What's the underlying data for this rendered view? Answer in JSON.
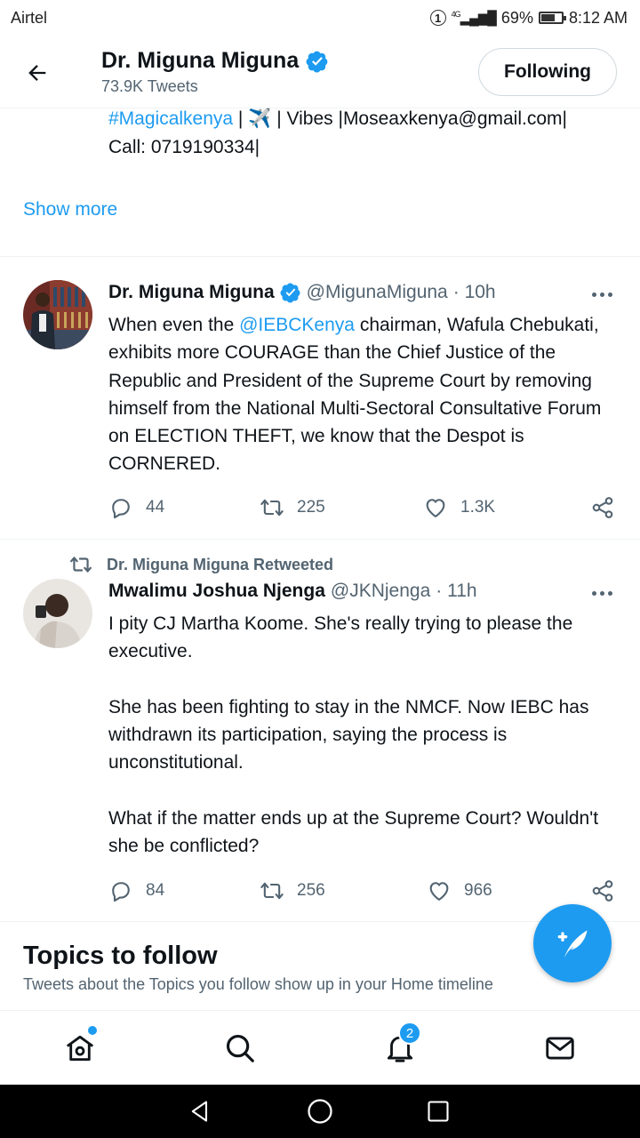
{
  "status": {
    "carrier": "Airtel",
    "net": "4G",
    "battery": "69%",
    "battery_level": 0.69,
    "time": "8:12 AM"
  },
  "header": {
    "name": "Dr. Miguna Miguna",
    "tweets_count": "73.9K Tweets",
    "follow_label": "Following"
  },
  "bio": {
    "hashtag": "#Magicalkenya",
    "sep1": " | ",
    "sep2": " | Vibes |Moseaxkenya@gmail.com|",
    "line2": "Call: 0719190334|",
    "plane_emoji": "✈️",
    "show_more": "Show more"
  },
  "tweet1": {
    "name": "Dr. Miguna Miguna",
    "handle": "@MigunaMiguna",
    "time": "· 10h",
    "text_pre": "When even the ",
    "mention": "@IEBCKenya",
    "text_post": " chairman, Wafula Chebukati, exhibits more COURAGE than the Chief Justice of the Republic and President of the Supreme Court by removing himself from the National Multi-Sectoral Consultative Forum on ELECTION THEFT, we know that the Despot is CORNERED.",
    "replies": "44",
    "retweets": "225",
    "likes": "1.3K"
  },
  "tweet2": {
    "rt_label": "Dr. Miguna Miguna Retweeted",
    "name": "Mwalimu Joshua Njenga",
    "handle": "@JKNjenga",
    "time": "· 11h",
    "para1": "I pity CJ Martha Koome. She's really trying to please the executive.",
    "para2": "She has been fighting to stay in the NMCF. Now IEBC has withdrawn its participation, saying the process is unconstitutional.",
    "para3": "What if the matter ends up at the Supreme Court? Wouldn't she be conflicted?",
    "replies": "84",
    "retweets": "256",
    "likes": "966"
  },
  "topics": {
    "title": "Topics to follow",
    "subtitle": "Tweets about the Topics you follow show up in your Home timeline"
  },
  "nav": {
    "notifications_badge": "2"
  },
  "colors": {
    "accent": "#1d9bf0",
    "secondary_text": "#536471",
    "primary_text": "#0f1419"
  }
}
